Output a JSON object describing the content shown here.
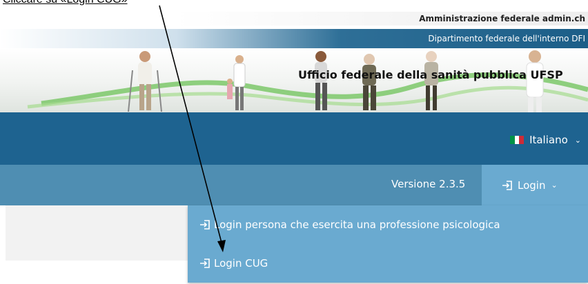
{
  "caption": "Cliccare su «Login CUG»",
  "header": {
    "admin_line": "Amministrazione federale admin.ch",
    "department": "Dipartimento federale dell'interno DFI",
    "office": "Ufficio federale della sanità pubblica UFSP"
  },
  "language": {
    "selected": "Italiano",
    "flag_colors": [
      "#009246",
      "#ffffff",
      "#ce2b37"
    ]
  },
  "nav": {
    "version": "Versione 2.3.5",
    "login_label": "Login"
  },
  "login_menu": {
    "items": [
      {
        "label": "Login persona che esercita una professione psicologica"
      },
      {
        "label": "Login CUG"
      }
    ]
  },
  "colors": {
    "lang_bar": "#1e6390",
    "nav_bar": "#4f8eb2",
    "dropdown": "#6aaad0"
  },
  "icons": [
    "login-icon",
    "chevron-down-icon",
    "italy-flag-icon"
  ]
}
